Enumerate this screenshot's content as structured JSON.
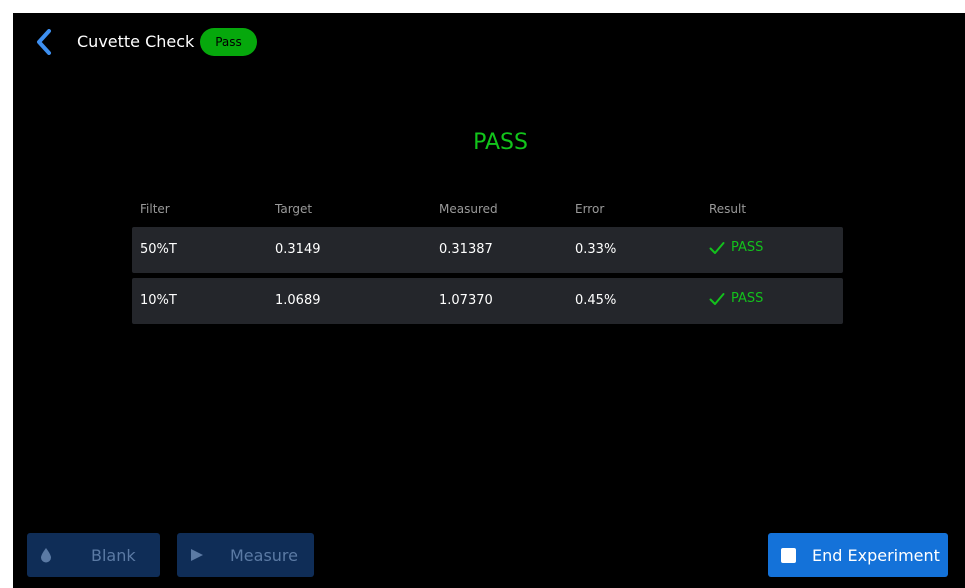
{
  "header": {
    "title": "Cuvette Check",
    "status_badge": "Pass",
    "back_icon": "chevron-left-icon"
  },
  "result": {
    "heading": "PASS"
  },
  "table": {
    "columns": [
      "Filter",
      "Target",
      "Measured",
      "Error",
      "Result"
    ],
    "rows": [
      {
        "filter": "50%T",
        "target": "0.3149",
        "measured": "0.31387",
        "error": "0.33%",
        "result": "PASS"
      },
      {
        "filter": "10%T",
        "target": "1.0689",
        "measured": "1.07370",
        "error": "0.45%",
        "result": "PASS"
      }
    ]
  },
  "actions": {
    "blank_label": "Blank",
    "blank_icon": "droplet-icon",
    "measure_label": "Measure",
    "measure_icon": "play-icon",
    "end_label": "End Experiment",
    "end_icon": "stop-square-icon"
  },
  "colors": {
    "background": "#000000",
    "pass_green": "#12c41b",
    "badge_green": "#06a80c",
    "accent_blue": "#1472d9",
    "row_bg": "#24262b"
  }
}
